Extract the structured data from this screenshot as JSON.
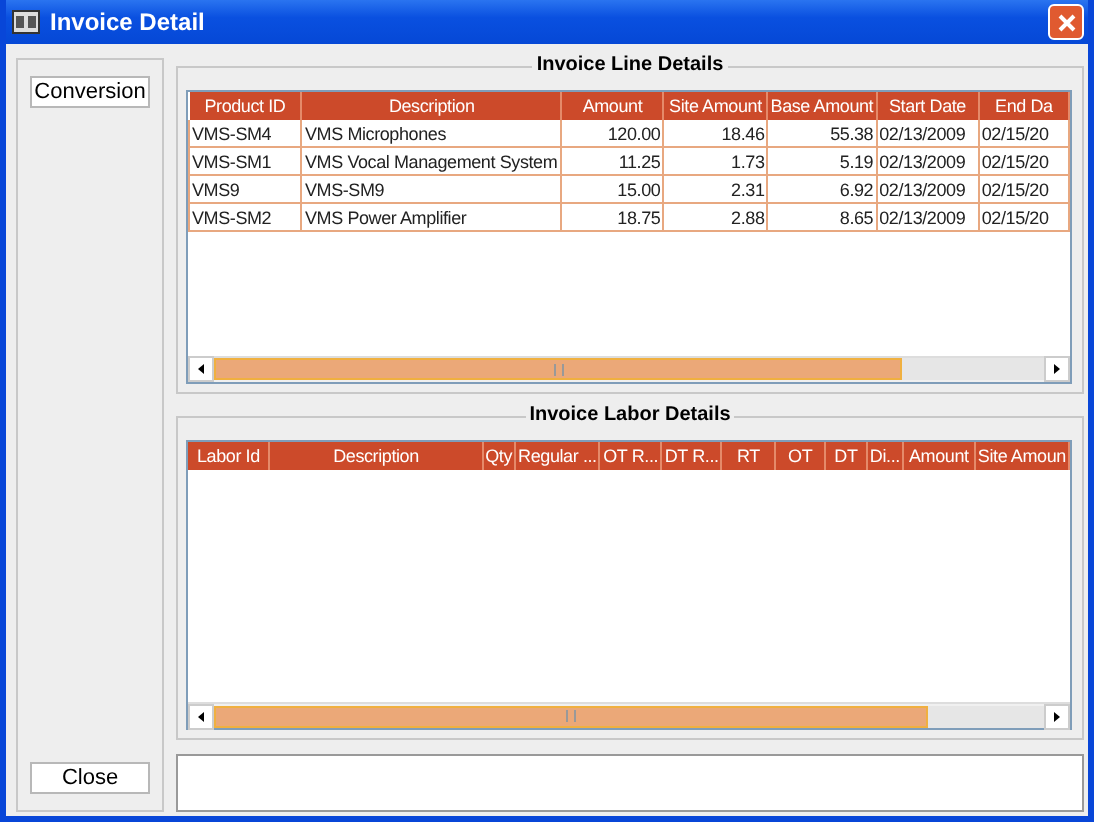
{
  "window": {
    "title": "Invoice Detail"
  },
  "sidebar": {
    "buttons": [
      "Conversion",
      "Close"
    ]
  },
  "invoice_line_details": {
    "title": "Invoice Line Details",
    "columns": [
      "Product ID",
      "Description",
      "Amount",
      "Site Amount",
      "Base Amount",
      "Start Date",
      "End Da"
    ],
    "rows": [
      [
        "VMS-SM4",
        "VMS Microphones",
        "120.00",
        "18.46",
        "55.38",
        "02/13/2009",
        "02/15/20"
      ],
      [
        "VMS-SM1",
        "VMS Vocal Management System",
        "11.25",
        "1.73",
        "5.19",
        "02/13/2009",
        "02/15/20"
      ],
      [
        "VMS9",
        "VMS-SM9",
        "15.00",
        "2.31",
        "6.92",
        "02/13/2009",
        "02/15/20"
      ],
      [
        "VMS-SM2",
        "VMS Power Amplifier",
        "18.75",
        "2.88",
        "8.65",
        "02/13/2009",
        "02/15/20"
      ]
    ]
  },
  "invoice_labor_details": {
    "title": "Invoice Labor Details",
    "columns": [
      "Labor Id",
      "Description",
      "Qty",
      "Regular ...",
      "OT R...",
      "DT R...",
      "RT",
      "OT",
      "DT",
      "Di...",
      "Amount",
      "Site Amoun"
    ]
  }
}
